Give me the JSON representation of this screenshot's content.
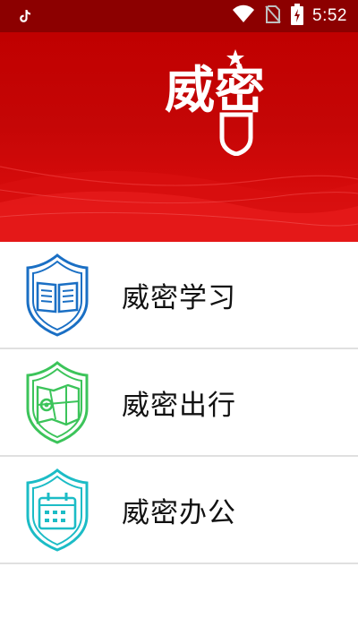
{
  "status_bar": {
    "time": "5:52",
    "icons": [
      "tiktok-icon",
      "wifi-icon",
      "no-sim-icon",
      "battery-charging-icon"
    ]
  },
  "banner": {
    "logo_text": "威密",
    "logo_icons": [
      "star-icon",
      "shield-icon"
    ],
    "colors": {
      "background": "#c00000",
      "wave": "#e62020"
    }
  },
  "menu": {
    "items": [
      {
        "label": "威密学习",
        "icon": "book-shield-icon",
        "color": "#1a6fc4"
      },
      {
        "label": "威密出行",
        "icon": "map-pin-shield-icon",
        "color": "#3cc45a"
      },
      {
        "label": "威密办公",
        "icon": "calendar-shield-icon",
        "color": "#1cbcc6"
      }
    ]
  }
}
